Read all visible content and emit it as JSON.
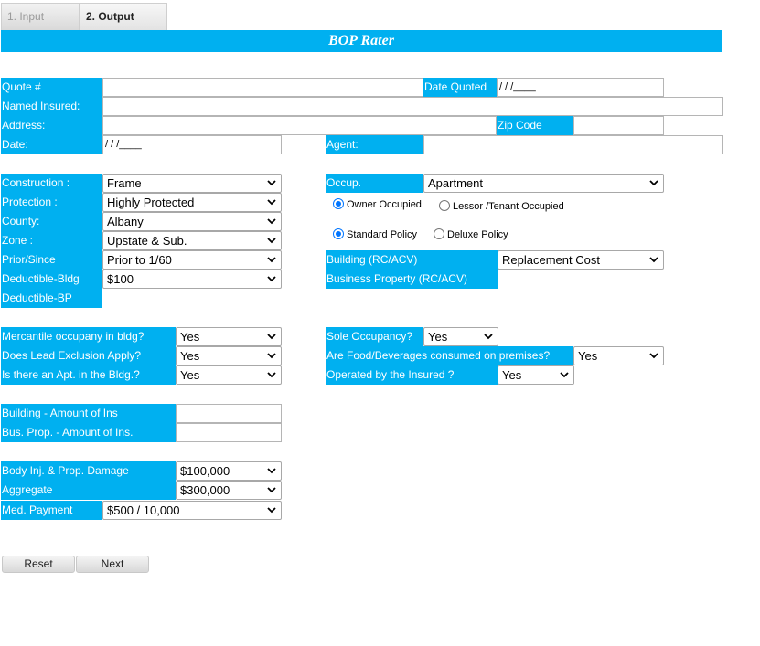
{
  "tabs": [
    {
      "label": "1. Input"
    },
    {
      "label": "2. Output"
    }
  ],
  "title": "BOP Rater",
  "header": {
    "quote_label": "Quote #",
    "quote_value": "",
    "date_quoted_label": "Date Quoted",
    "date_quoted_value": "/ / /____",
    "named_insured_label": "Named Insured:",
    "named_insured_value": "",
    "address_label": "Address:",
    "address_value": "",
    "zip_label": "Zip Code",
    "zip_value": "",
    "date_label": "Date:",
    "date_value": "/ / /____",
    "agent_label": "Agent:",
    "agent_value": ""
  },
  "risk": {
    "construction_label": "Construction :",
    "construction_value": "Frame",
    "protection_label": "Protection :",
    "protection_value": "Highly Protected",
    "county_label": "County:",
    "county_value": "Albany",
    "zone_label": "Zone :",
    "zone_value": "Upstate & Sub.",
    "prior_label": "Prior/Since",
    "prior_value": "Prior to 1/60",
    "ded_bldg_label": "Deductible-Bldg",
    "ded_bldg_value": "$100",
    "ded_bp_label": "Deductible-BP"
  },
  "occupancy": {
    "occup_label": "Occup.",
    "occup_value": "Apartment",
    "owner_occupied": "Owner Occupied",
    "lessor_tenant": "Lessor /Tenant Occupied",
    "standard_policy": "Standard Policy",
    "deluxe_policy": "Deluxe Policy",
    "building_label": "Building (RC/ACV)",
    "building_value": "Replacement Cost",
    "business_property_label": "Business Property (RC/ACV)"
  },
  "questions": {
    "mercantile_label": "Mercantile occupany in bldg?",
    "mercantile_value": "Yes",
    "lead_label": "Does Lead Exclusion Apply?",
    "lead_value": "Yes",
    "apt_label": "Is there an Apt. in the Bldg.?",
    "apt_value": "Yes",
    "sole_label": "Sole Occupancy?",
    "sole_value": "Yes",
    "food_label": "Are Food/Beverages consumed on premises?",
    "food_value": "Yes",
    "operated_label": "Operated by  the Insured ?",
    "operated_value": "Yes"
  },
  "amounts": {
    "building_label": "Building - Amount of Ins",
    "building_value": "",
    "busprop_label": "Bus. Prop. - Amount of Ins.",
    "busprop_value": ""
  },
  "liability": {
    "bodily_label": "Body Inj. & Prop. Damage",
    "bodily_value": "$100,000",
    "aggregate_label": "Aggregate",
    "aggregate_value": "$300,000",
    "med_label": "Med. Payment",
    "med_value": "$500 / 10,000"
  },
  "buttons": {
    "reset": "Reset",
    "next": "Next"
  },
  "colors": {
    "accent": "#00b0f0"
  }
}
